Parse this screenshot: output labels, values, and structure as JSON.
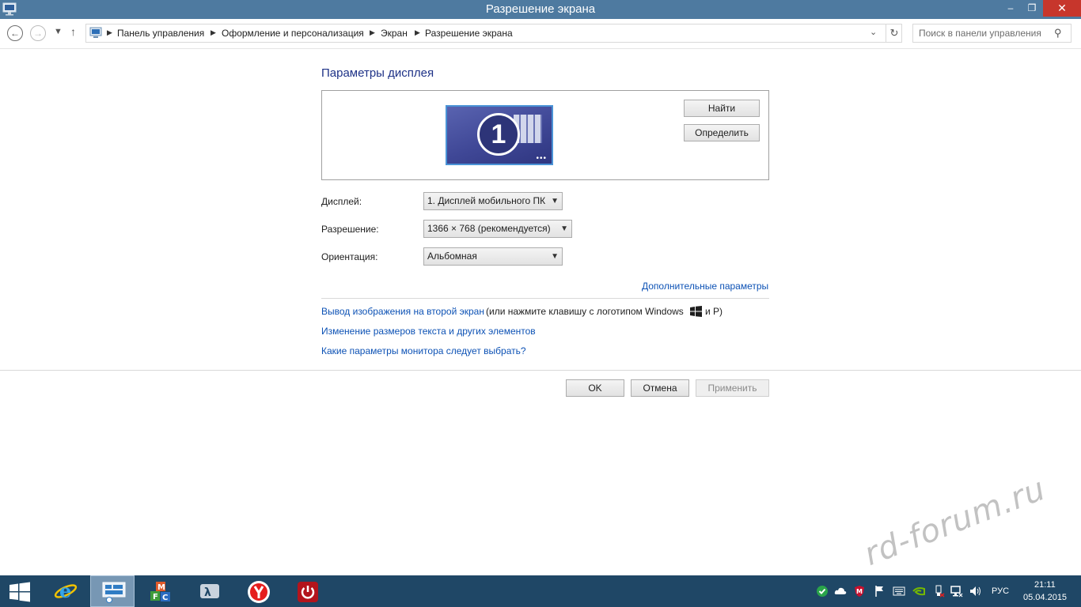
{
  "window": {
    "title": "Разрешение экрана",
    "controls": {
      "minimize": "‒",
      "maximize": "❐",
      "close": "✕"
    }
  },
  "navigation": {
    "breadcrumbs": [
      "Панель управления",
      "Оформление и персонализация",
      "Экран",
      "Разрешение экрана"
    ],
    "search_placeholder": "Поиск в панели управления"
  },
  "main": {
    "heading": "Параметры дисплея",
    "find_button": "Найти",
    "identify_button": "Определить",
    "monitor_number": "1",
    "fields": {
      "display_label": "Дисплей:",
      "display_value": "1. Дисплей мобильного ПК",
      "resolution_label": "Разрешение:",
      "resolution_value": "1366 × 768 (рекомендуется)",
      "orientation_label": "Ориентация:",
      "orientation_value": "Альбомная"
    },
    "advanced_link": "Дополнительные параметры",
    "project_link": "Вывод изображения на второй экран",
    "project_note_1": "(или нажмите клавишу с логотипом Windows",
    "project_note_2": "и P)",
    "text_size_link": "Изменение размеров текста и других элементов",
    "which_settings_link": "Какие параметры монитора следует выбрать?"
  },
  "footer": {
    "ok": "OK",
    "cancel": "Отмена",
    "apply": "Применить"
  },
  "watermark": "rd-forum.ru",
  "taskbar": {
    "language": "РУС",
    "time": "21:11",
    "date": "05.04.2015",
    "accent_color": "#1f4766"
  }
}
